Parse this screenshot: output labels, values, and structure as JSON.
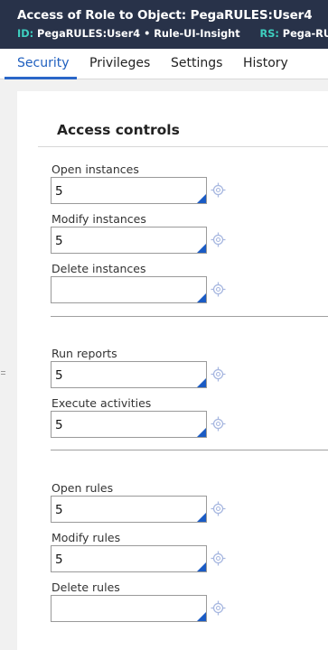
{
  "header": {
    "title": "Access of Role to Object: PegaRULES:User4",
    "meta": [
      {
        "key": "ID:",
        "value": "PegaRULES:User4 • Rule-UI-Insight"
      },
      {
        "key": "RS:",
        "value": "Pega-RULES"
      }
    ]
  },
  "tabs": [
    {
      "label": "Security",
      "active": true
    },
    {
      "label": "Privileges",
      "active": false
    },
    {
      "label": "Settings",
      "active": false
    },
    {
      "label": "History",
      "active": false
    }
  ],
  "section": {
    "title": "Access controls"
  },
  "fields": [
    {
      "label": "Open instances",
      "value": "5"
    },
    {
      "label": "Modify instances",
      "value": "5"
    },
    {
      "label": "Delete instances",
      "value": ""
    },
    {
      "label": "Run reports",
      "value": "5"
    },
    {
      "label": "Execute activities",
      "value": "5"
    },
    {
      "label": "Open rules",
      "value": "5"
    },
    {
      "label": "Modify rules",
      "value": "5"
    },
    {
      "label": "Delete rules",
      "value": ""
    }
  ],
  "colors": {
    "header_bg": "#283249",
    "meta_key": "#3ed0c0",
    "accent": "#2a66c8",
    "field_corner": "#1a5bc4",
    "target_icon": "#a7b7e0"
  },
  "icons": {
    "field_action": "target-icon"
  }
}
